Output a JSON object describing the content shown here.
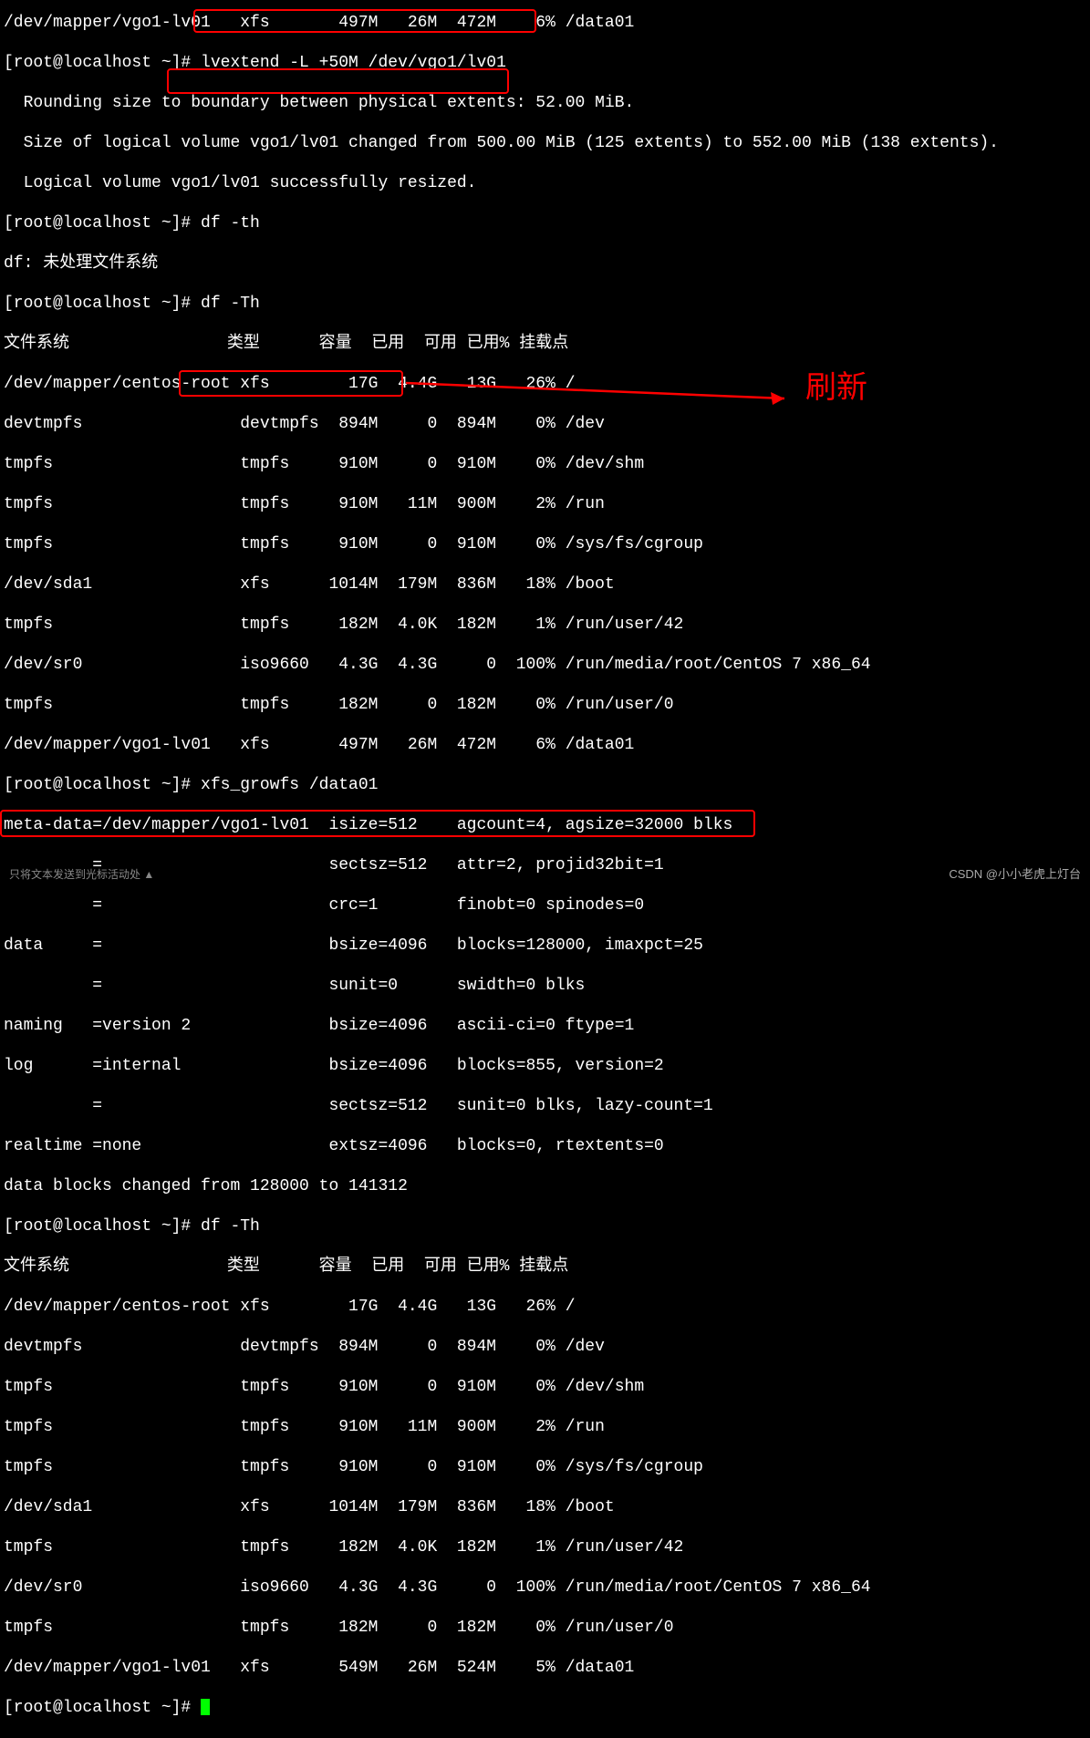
{
  "lines": {
    "l0": "/dev/mapper/vgo1-lv01   xfs       497M   26M  472M    6% /data01",
    "l1": "[root@localhost ~]# lvextend -L +50M /dev/vgo1/lv01",
    "l2": "  Rounding size to boundary between physical extents: 52.00 MiB.",
    "l3": "  Size of logical volume vgo1/lv01 changed from 500.00 MiB (125 extents) to 552.00 MiB (138 extents).",
    "l4": "  Logical volume vgo1/lv01 successfully resized.",
    "l5": "[root@localhost ~]# df -th",
    "l6": "df: 未处理文件系统",
    "l7": "[root@localhost ~]# df -Th",
    "l8": "文件系统                类型      容量  已用  可用 已用% 挂载点",
    "l9": "/dev/mapper/centos-root xfs        17G  4.4G   13G   26% /",
    "l10": "devtmpfs                devtmpfs  894M     0  894M    0% /dev",
    "l11": "tmpfs                   tmpfs     910M     0  910M    0% /dev/shm",
    "l12": "tmpfs                   tmpfs     910M   11M  900M    2% /run",
    "l13": "tmpfs                   tmpfs     910M     0  910M    0% /sys/fs/cgroup",
    "l14": "/dev/sda1               xfs      1014M  179M  836M   18% /boot",
    "l15": "tmpfs                   tmpfs     182M  4.0K  182M    1% /run/user/42",
    "l16": "/dev/sr0                iso9660   4.3G  4.3G     0  100% /run/media/root/CentOS 7 x86_64",
    "l17": "tmpfs                   tmpfs     182M     0  182M    0% /run/user/0",
    "l18": "/dev/mapper/vgo1-lv01   xfs       497M   26M  472M    6% /data01",
    "l19": "[root@localhost ~]# xfs_growfs /data01",
    "l20": "meta-data=/dev/mapper/vgo1-lv01  isize=512    agcount=4, agsize=32000 blks",
    "l21": "         =                       sectsz=512   attr=2, projid32bit=1",
    "l22": "         =                       crc=1        finobt=0 spinodes=0",
    "l23": "data     =                       bsize=4096   blocks=128000, imaxpct=25",
    "l24": "         =                       sunit=0      swidth=0 blks",
    "l25": "naming   =version 2              bsize=4096   ascii-ci=0 ftype=1",
    "l26": "log      =internal               bsize=4096   blocks=855, version=2",
    "l27": "         =                       sectsz=512   sunit=0 blks, lazy-count=1",
    "l28": "realtime =none                   extsz=4096   blocks=0, rtextents=0",
    "l29": "data blocks changed from 128000 to 141312",
    "l30": "[root@localhost ~]# df -Th",
    "l31": "文件系统                类型      容量  已用  可用 已用% 挂载点",
    "l32": "/dev/mapper/centos-root xfs        17G  4.4G   13G   26% /",
    "l33": "devtmpfs                devtmpfs  894M     0  894M    0% /dev",
    "l34": "tmpfs                   tmpfs     910M     0  910M    0% /dev/shm",
    "l35": "tmpfs                   tmpfs     910M   11M  900M    2% /run",
    "l36": "tmpfs                   tmpfs     910M     0  910M    0% /sys/fs/cgroup",
    "l37": "/dev/sda1               xfs      1014M  179M  836M   18% /boot",
    "l38": "tmpfs                   tmpfs     182M  4.0K  182M    1% /run/user/42",
    "l39": "/dev/sr0                iso9660   4.3G  4.3G     0  100% /run/media/root/CentOS 7 x86_64",
    "l40": "tmpfs                   tmpfs     182M     0  182M    0% /run/user/0",
    "l41": "/dev/mapper/vgo1-lv01   xfs       549M   26M  524M    5% /data01",
    "l42": "[root@localhost ~]# "
  },
  "annotations": {
    "refresh": "刷新"
  },
  "watermark": "CSDN @小小老虎上灯台",
  "bottom": "只将文本发送到光标活动处 ▲"
}
